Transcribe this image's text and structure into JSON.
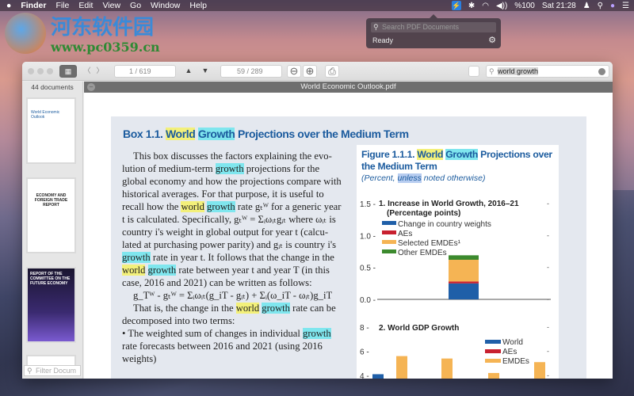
{
  "menubar": {
    "apple": "",
    "items": [
      "Finder",
      "File",
      "Edit",
      "View",
      "Go",
      "Window",
      "Help"
    ],
    "status": {
      "pdf": "⚡",
      "bluetooth": "✱",
      "wifi": "◠",
      "volume": "◀))",
      "battery": "%100",
      "clock": "Sat 21:28",
      "user": "♟",
      "search": "⚲",
      "siri": "●",
      "list": "☰"
    }
  },
  "watermark": {
    "cn": "河东软件园",
    "url": "www.pc0359.cn"
  },
  "popover": {
    "search_placeholder": "Search PDF Documents",
    "status": "Ready",
    "gear": "⚙"
  },
  "toolbar": {
    "grid": "▦",
    "back": "〈",
    "forward": "〉",
    "page_search": "1 / 619",
    "up": "▲",
    "down": "▼",
    "page_field": "59 / 289",
    "zoom_out": "⊖",
    "zoom_in": "⊕",
    "print": "⎙",
    "search_value": "world growth"
  },
  "sidebar": {
    "count": "44 documents",
    "filter_placeholder": "Filter Docum",
    "thumbs": [
      "World Economic Outlook",
      "ECONOMY AND FOREIGN TRADE REPORT",
      "REPORT OF THE COMMITTEE ON THE FUTURE ECONOMY"
    ]
  },
  "document": {
    "title": "World Economic Outlook.pdf",
    "box_title": [
      {
        "t": "Box 1.1. ",
        "h": ""
      },
      {
        "t": "World",
        "h": "y"
      },
      {
        "t": " ",
        "h": ""
      },
      {
        "t": "Growth",
        "h": "c"
      },
      {
        "t": " Projections over the Medium Term",
        "h": ""
      }
    ],
    "lines": [
      [
        {
          "t": "This box discusses the factors explaining the evo-",
          "h": "",
          "i": 1
        }
      ],
      [
        {
          "t": "lution of medium-term ",
          "h": ""
        },
        {
          "t": "growth",
          "h": "c"
        },
        {
          "t": " projections for the",
          "h": ""
        }
      ],
      [
        {
          "t": "global economy and how the projections compare with",
          "h": ""
        }
      ],
      [
        {
          "t": "historical averages. For that purpose, it is useful to",
          "h": ""
        }
      ],
      [
        {
          "t": "recall how the ",
          "h": ""
        },
        {
          "t": "world",
          "h": "y"
        },
        {
          "t": " ",
          "h": ""
        },
        {
          "t": "growth",
          "h": "c"
        },
        {
          "t": " rate gₜᵂ for a generic year",
          "h": ""
        }
      ],
      [
        {
          "t": "t is calculated. Specifically, gₜᵂ = Σᵢωᵢₜgᵢₜ where ωᵢₜ is",
          "h": ""
        }
      ],
      [
        {
          "t": "country i's weight in global output for year t (calcu-",
          "h": ""
        }
      ],
      [
        {
          "t": "lated at purchasing power parity) and gᵢₜ is country i's",
          "h": ""
        }
      ],
      [
        {
          "t": "growth",
          "h": "c"
        },
        {
          "t": " rate in year t. It follows that the change in the",
          "h": ""
        }
      ],
      [
        {
          "t": "world",
          "h": "y"
        },
        {
          "t": " ",
          "h": ""
        },
        {
          "t": "growth",
          "h": "c"
        },
        {
          "t": " rate between year t and year T (in this",
          "h": ""
        }
      ],
      [
        {
          "t": "case, 2016 and 2021) can be written as follows:",
          "h": ""
        }
      ],
      [
        {
          "t": " ",
          "h": ""
        }
      ],
      [
        {
          "t": "g_Tᵂ - gₜᵂ = Σᵢωᵢₜ(g_iT - gᵢₜ) + Σᵢ(ω_iT - ωᵢₜ)g_iT",
          "h": "",
          "i": 1
        }
      ],
      [
        {
          "t": " ",
          "h": ""
        }
      ],
      [
        {
          "t": "That is, the change in the ",
          "h": "",
          "i": 1
        },
        {
          "t": "world",
          "h": "y"
        },
        {
          "t": " ",
          "h": ""
        },
        {
          "t": "growth",
          "h": "c"
        },
        {
          "t": " rate can be",
          "h": ""
        }
      ],
      [
        {
          "t": "decomposed into two terms:",
          "h": ""
        }
      ],
      [
        {
          "t": "•  The weighted sum of changes in individual ",
          "h": ""
        },
        {
          "t": "growth",
          "h": "c"
        }
      ],
      [
        {
          "t": "    rate forecasts between 2016 and 2021 (using 2016",
          "h": ""
        }
      ],
      [
        {
          "t": "    weights)",
          "h": ""
        }
      ]
    ],
    "figure_title": [
      {
        "t": "Figure 1.1.1.  ",
        "h": ""
      },
      {
        "t": "World",
        "h": "y"
      },
      {
        "t": " ",
        "h": ""
      },
      {
        "t": "Growth",
        "h": "c"
      },
      {
        "t": " Projections over the Medium Term",
        "h": ""
      }
    ],
    "figure_subtitle": [
      {
        "t": "(Percent, ",
        "h": ""
      },
      {
        "t": "unless",
        "h": "b"
      },
      {
        "t": " noted otherwise)",
        "h": ""
      }
    ]
  },
  "colors": {
    "blue": "#1f5fa8",
    "red": "#c8202f",
    "orange": "#f5b454",
    "green": "#3c8a2e",
    "highlight_yellow": "#f3f07a",
    "highlight_cyan": "#7fe6ee"
  },
  "chart_data": [
    {
      "type": "bar",
      "title": "1. Increase in World Growth, 2016–21",
      "subtitle": "(Percentage points)",
      "ylim": [
        0,
        1.5
      ],
      "yticks": [
        "0.0",
        "0.5",
        "1.0",
        "1.5"
      ],
      "series": [
        {
          "name": "Change in country weights",
          "values": [
            0.25
          ]
        },
        {
          "name": "AEs",
          "values": [
            0.03
          ]
        },
        {
          "name": "Selected EMDEs¹",
          "values": [
            0.34
          ]
        },
        {
          "name": "Other EMDEs",
          "values": [
            0.07
          ]
        }
      ],
      "stacked": true,
      "legend": "top-left"
    },
    {
      "type": "bar",
      "title": "2. World GDP Growth",
      "ylim": [
        4,
        8
      ],
      "yticks": [
        "4",
        "6",
        "8"
      ],
      "series": [
        {
          "name": "World",
          "values": [
            4.1
          ]
        },
        {
          "name": "AEs",
          "values": []
        },
        {
          "name": "EMDEs",
          "values": [
            5.6,
            5.4,
            4.2,
            5.1
          ]
        }
      ],
      "legend": "top-right"
    }
  ]
}
